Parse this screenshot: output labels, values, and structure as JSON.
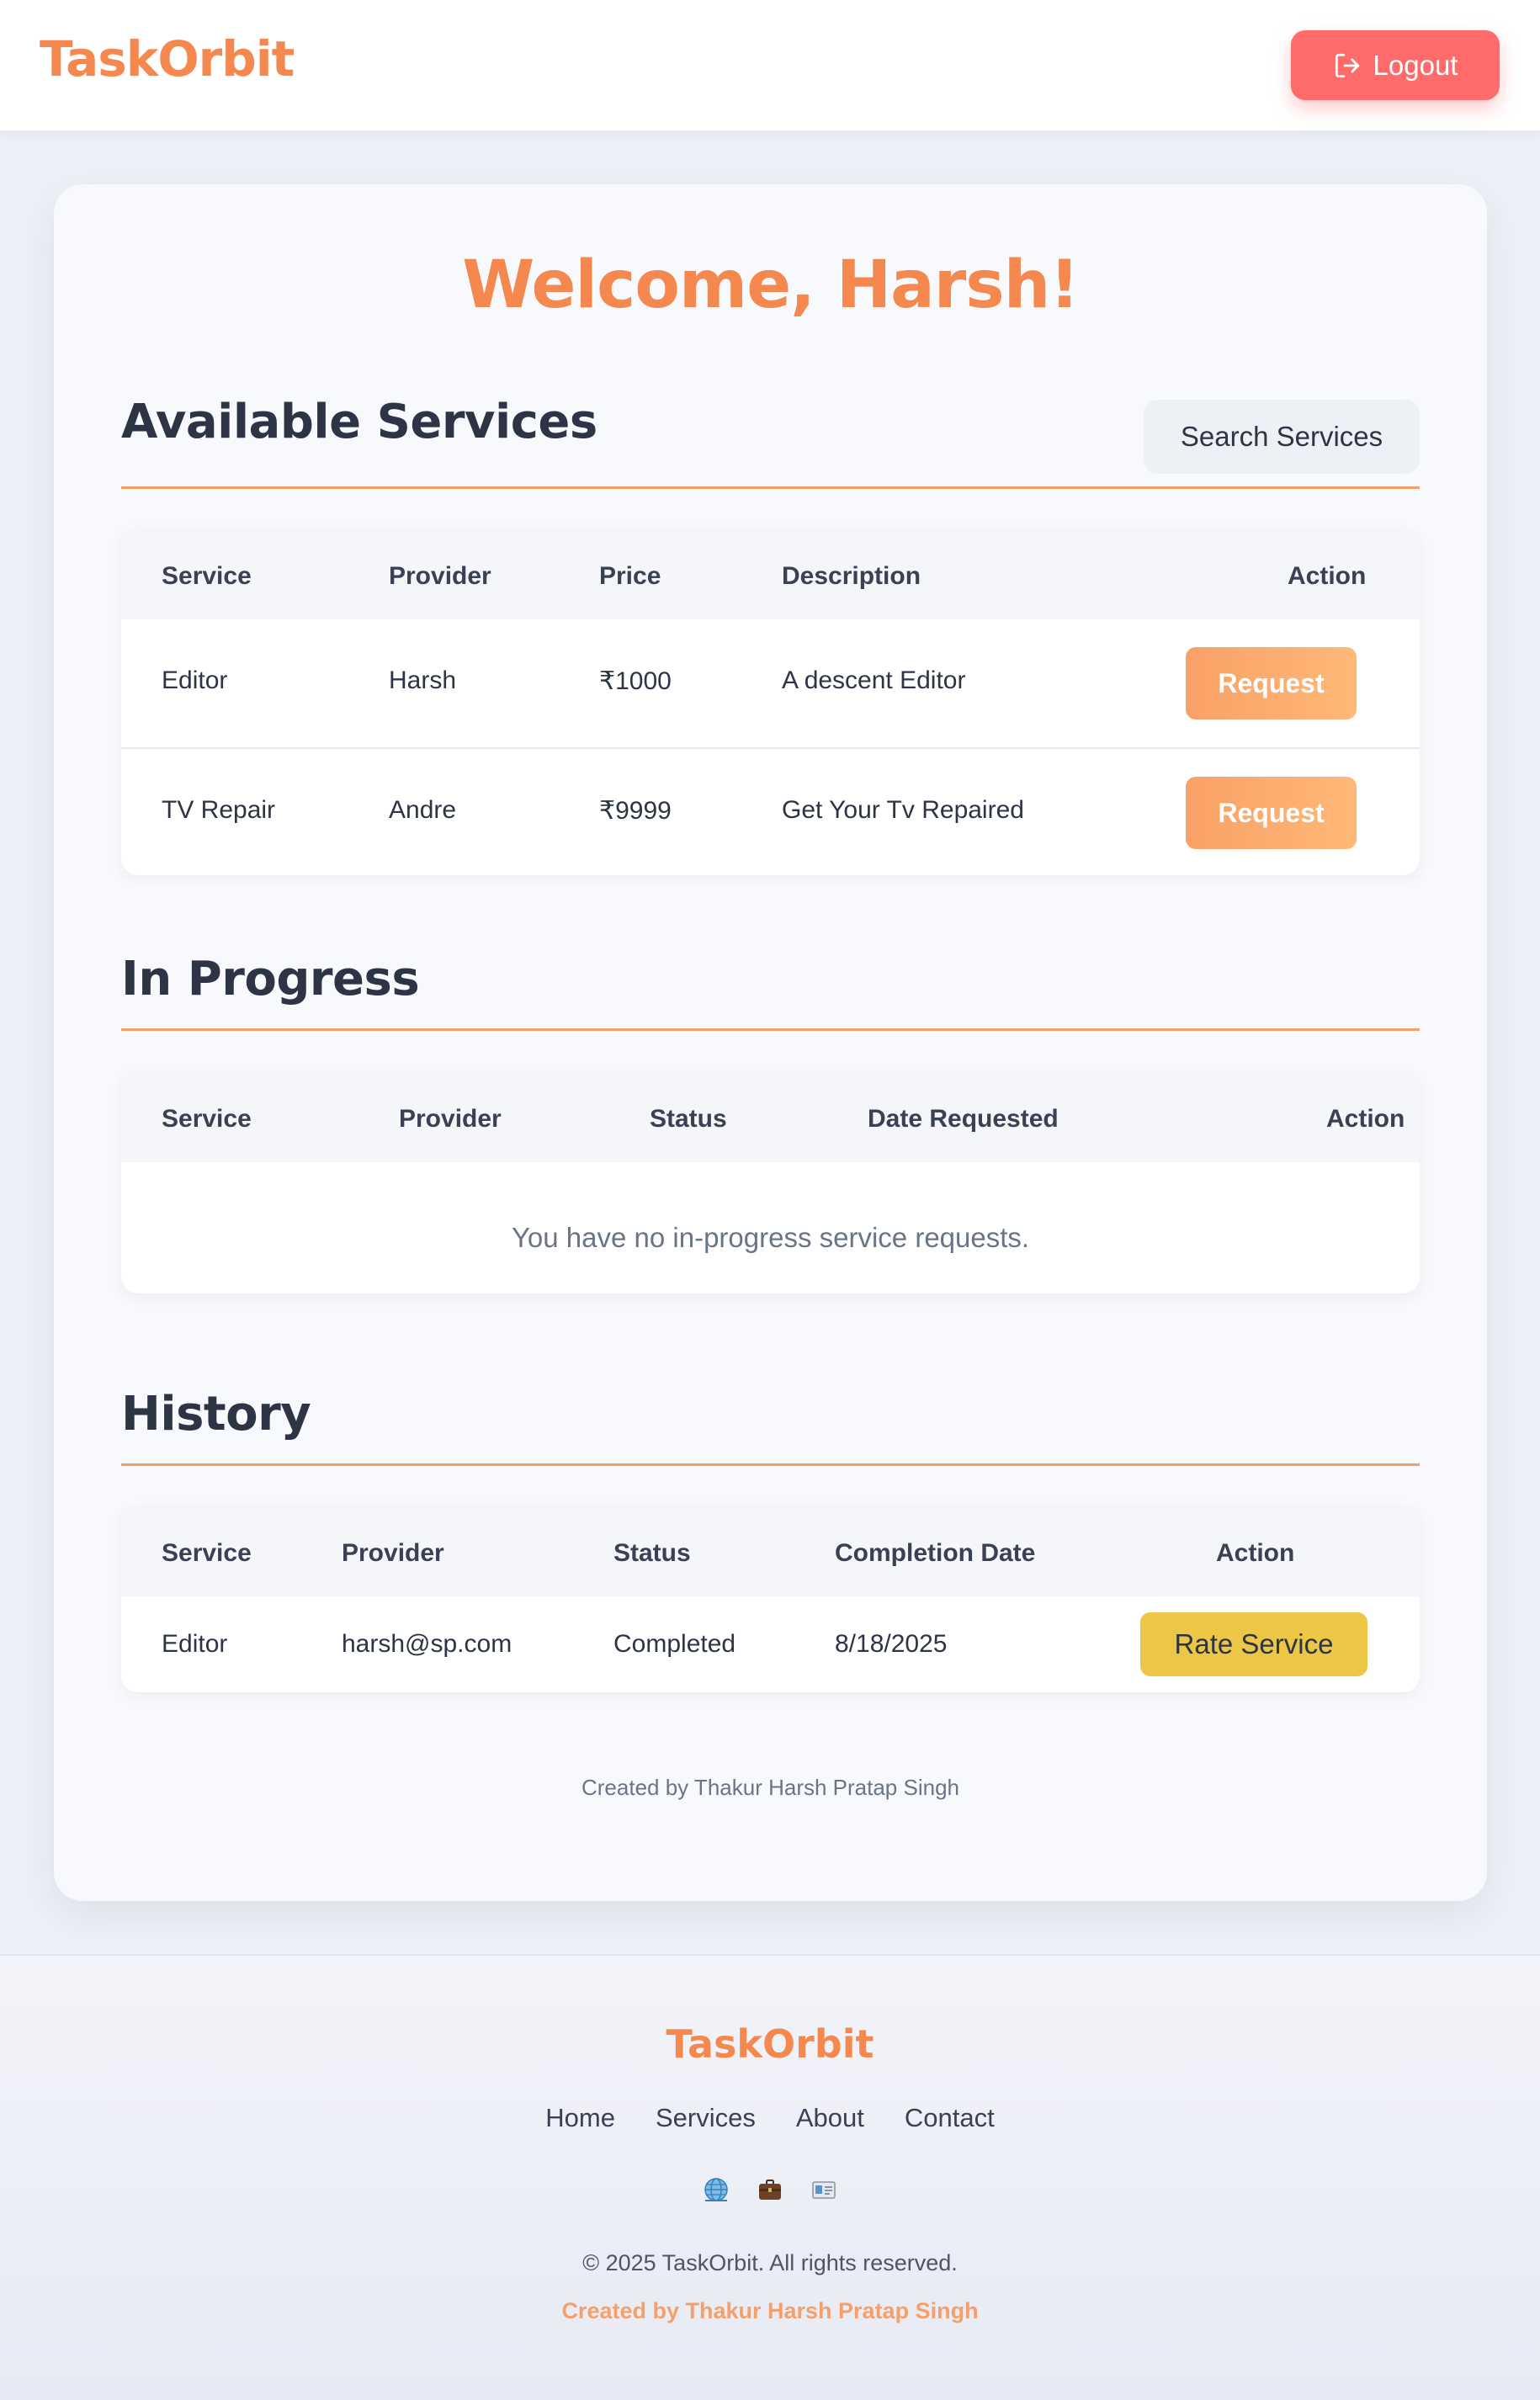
{
  "header": {
    "brand": "TaskOrbit",
    "logout_label": "Logout"
  },
  "welcome": "Welcome, Harsh!",
  "available": {
    "title": "Available Services",
    "search_label": "Search Services",
    "columns": [
      "Service",
      "Provider",
      "Price",
      "Description",
      "Action"
    ],
    "rows": [
      {
        "service": "Editor",
        "provider": "Harsh",
        "price": "₹1000",
        "description": "A descent Editor",
        "action": "Request"
      },
      {
        "service": "TV Repair",
        "provider": "Andre",
        "price": "₹9999",
        "description": "Get Your Tv Repaired",
        "action": "Request"
      }
    ]
  },
  "in_progress": {
    "title": "In Progress",
    "columns": [
      "Service",
      "Provider",
      "Status",
      "Date Requested",
      "Action"
    ],
    "empty_message": "You have no in-progress service requests."
  },
  "history": {
    "title": "History",
    "columns": [
      "Service",
      "Provider",
      "Status",
      "Completion Date",
      "Action"
    ],
    "rows": [
      {
        "service": "Editor",
        "provider": "harsh@sp.com",
        "status": "Completed",
        "date": "8/18/2025",
        "action": "Rate Service"
      }
    ]
  },
  "credit": "Created by Thakur Harsh Pratap Singh",
  "footer": {
    "brand": "TaskOrbit",
    "nav": [
      "Home",
      "Services",
      "About",
      "Contact"
    ],
    "icons": [
      "globe-icon",
      "briefcase-icon",
      "id-card-icon"
    ],
    "copyright": "© 2025 TaskOrbit. All rights reserved.",
    "credit": "Created by Thakur Harsh Pratap Singh"
  },
  "colors": {
    "brand": "#f4884f",
    "logout": "#ff6b6b",
    "request": "#f9a167",
    "rate": "#ecc645"
  }
}
